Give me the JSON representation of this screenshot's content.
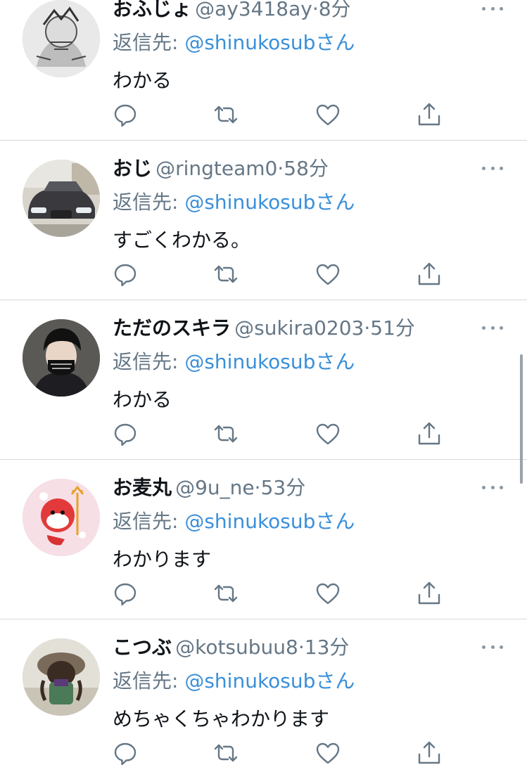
{
  "replying_prefix": "返信先: ",
  "colors": {
    "mention": "#3a8fd9",
    "secondary": "#657786",
    "divider": "#d5d9dc"
  },
  "tweets": [
    {
      "name": "おふじょ",
      "handle": "@ay3418ay",
      "time": "8分",
      "mention": "@shinukosub",
      "mention_suffix": "さん",
      "text": "わかる",
      "avatar_icon": "sketch-portrait-avatar"
    },
    {
      "name": "おじ",
      "handle": "@ringteam0",
      "time": "58分",
      "mention": "@shinukosub",
      "mention_suffix": "さん",
      "text": "すごくわかる。",
      "avatar_icon": "car-avatar"
    },
    {
      "name": "ただのスキラ",
      "handle": "@sukira0203",
      "time": "51分",
      "mention": "@shinukosub",
      "mention_suffix": "さん",
      "text": "わかる",
      "avatar_icon": "anime-character-avatar"
    },
    {
      "name": "お麦丸",
      "handle": "@9u_ne",
      "time": "53分",
      "mention": "@shinukosub",
      "mention_suffix": "さん",
      "text": "わかります",
      "avatar_icon": "red-imp-avatar"
    },
    {
      "name": "こつぶ",
      "handle": "@kotsubuu8",
      "time": "13分",
      "mention": "@shinukosub",
      "mention_suffix": "さん",
      "text": "めちゃくちゃわかります",
      "avatar_icon": "game-character-avatar"
    }
  ]
}
